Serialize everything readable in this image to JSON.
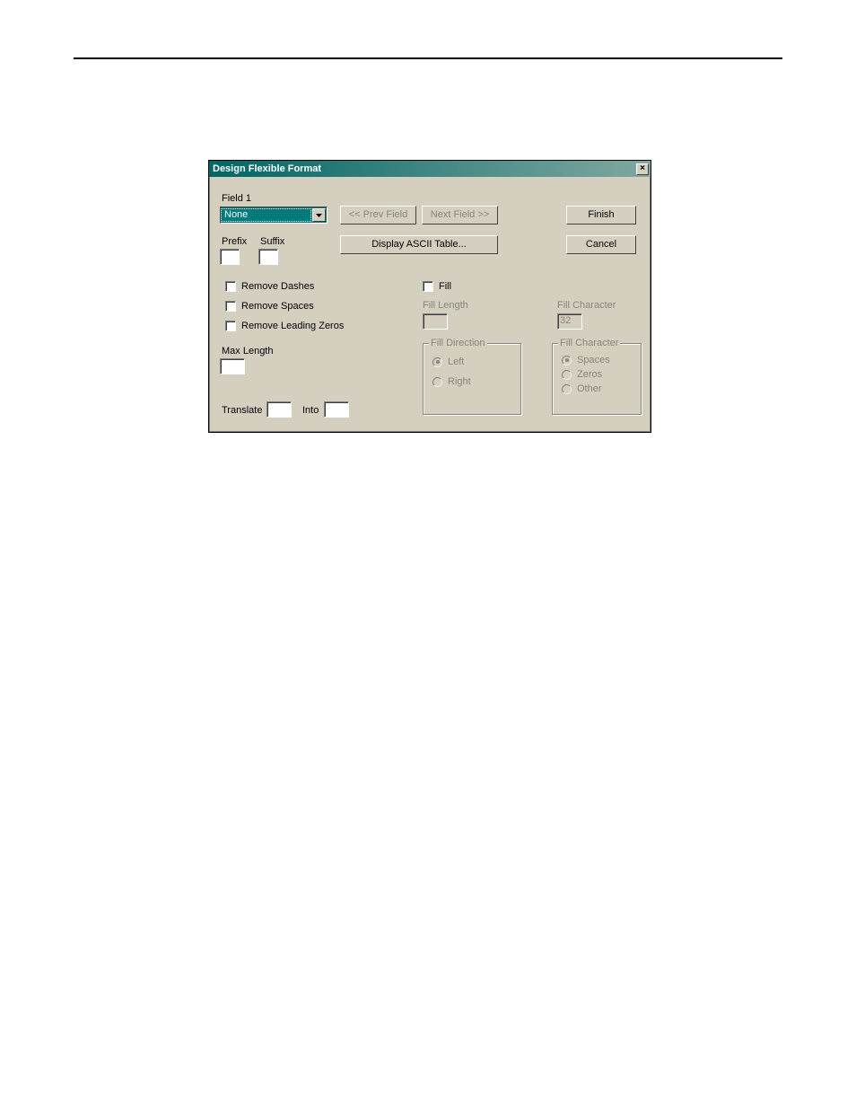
{
  "dialog": {
    "title": "Design Flexible Format",
    "close_symbol": "×",
    "field_label": "Field 1",
    "field_dropdown_value": "None",
    "prev_field_btn": "<< Prev Field",
    "next_field_btn": "Next Field >>",
    "prefix_label": "Prefix",
    "suffix_label": "Suffix",
    "display_ascii_btn": "Display ASCII Table...",
    "finish_btn": "Finish",
    "cancel_btn": "Cancel",
    "remove_dashes_label": "Remove Dashes",
    "remove_spaces_label": "Remove Spaces",
    "remove_leading_zeros_label": "Remove Leading Zeros",
    "fill_label": "Fill",
    "fill_length_label": "Fill Length",
    "fill_character_label": "Fill Character",
    "fill_character_value": "32",
    "max_length_label": "Max Length",
    "translate_label": "Translate",
    "into_label": "Into",
    "fill_direction_group": "Fill Direction",
    "fill_direction_left": "Left",
    "fill_direction_right": "Right",
    "fill_character_group": "Fill Character",
    "fill_char_spaces": "Spaces",
    "fill_char_zeros": "Zeros",
    "fill_char_other": "Other"
  }
}
